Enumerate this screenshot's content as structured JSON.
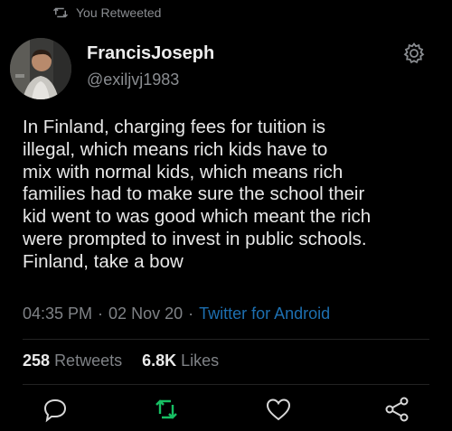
{
  "retweet_banner": {
    "label": "You Retweeted"
  },
  "user": {
    "name": "FrancisJoseph",
    "handle": "@exiljvj1983"
  },
  "tweet": {
    "text_lines": [
      "In Finland, charging fees for tuition is",
      "illegal, which means rich kids have to",
      "mix with normal kids, which means rich",
      "families had to make sure the school their",
      "kid went to was good which meant the rich",
      "were prompted to invest in public schools.",
      "Finland, take a bow"
    ],
    "time": "04:35 PM",
    "separator": "·",
    "date": "02 Nov 20",
    "source": "Twitter for Android"
  },
  "stats": {
    "retweets_count": "258",
    "retweets_label": "Retweets",
    "likes_count": "6.8K",
    "likes_label": "Likes"
  },
  "colors": {
    "accent": "#1d6fb0",
    "retweet_active": "#17bf63",
    "muted": "#7f8286"
  },
  "icons": [
    "retweet-icon",
    "gear-icon",
    "reply-icon",
    "retweet-icon",
    "like-icon",
    "share-icon"
  ]
}
